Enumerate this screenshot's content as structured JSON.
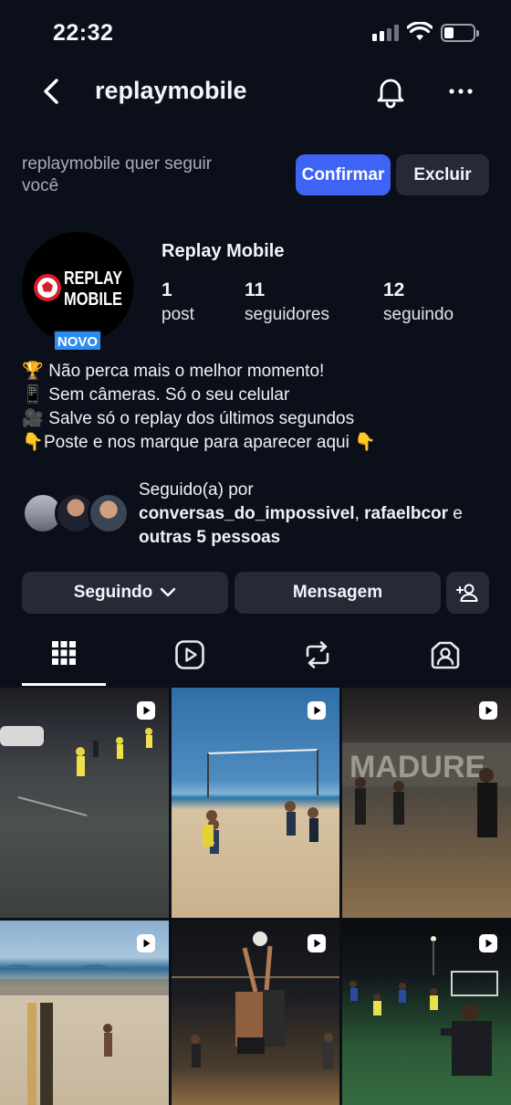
{
  "status_bar": {
    "time": "22:32"
  },
  "header": {
    "username": "replaymobile"
  },
  "follow_request": {
    "text": "replaymobile quer seguir você",
    "confirm_label": "Confirmar",
    "delete_label": "Excluir",
    "confirm_color": "#3f63f5"
  },
  "profile": {
    "display_name": "Replay Mobile",
    "new_badge": "NOVO",
    "avatar_logo": [
      "REPLAY",
      "MOBILE"
    ],
    "stats": [
      {
        "value": "1",
        "label": "post"
      },
      {
        "value": "11",
        "label": "seguidores"
      },
      {
        "value": "12",
        "label": "seguindo"
      }
    ]
  },
  "bio": [
    {
      "icon": "trophy-icon",
      "text": "Não perca mais o melhor momento!"
    },
    {
      "icon": "remote-icon",
      "text": "Sem câmeras. Só o seu celular"
    },
    {
      "icon": "movie-camera-icon",
      "text": "Salve só o replay dos últimos segundos"
    },
    {
      "icon": "pointing-down-icon",
      "text": "Poste e nos marque para aparecer aqui",
      "trailing_icon": "pointing-down-icon"
    }
  ],
  "followed_by": {
    "prefix": "Seguido(a) por",
    "user1": "conversas_do_impossivel",
    "separator": ",",
    "user2": "rafaelbcor",
    "conjunction": "e",
    "others": "outras 5 pessoas"
  },
  "actions": {
    "following_label": "Seguindo",
    "message_label": "Mensagem"
  },
  "tabs": [
    "grid-icon",
    "reels-icon",
    "reposts-icon",
    "tagged-icon"
  ],
  "grid": [
    {
      "label": "reel-thumbnail-night-football"
    },
    {
      "label": "reel-thumbnail-beach-volleyball"
    },
    {
      "label": "reel-thumbnail-madureira-court"
    },
    {
      "label": "reel-thumbnail-beach-footvolley"
    },
    {
      "label": "reel-thumbnail-volleyball-block"
    },
    {
      "label": "reel-thumbnail-goalkeeper"
    }
  ]
}
